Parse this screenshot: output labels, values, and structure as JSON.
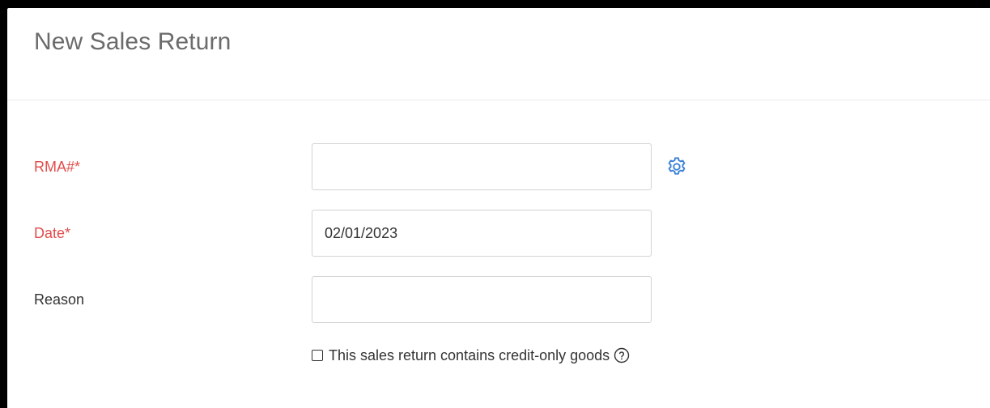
{
  "header": {
    "title": "New Sales Return"
  },
  "form": {
    "rma": {
      "label": "RMA#*",
      "value": "",
      "placeholder": ""
    },
    "date": {
      "label": "Date*",
      "value": "02/01/2023"
    },
    "reason": {
      "label": "Reason",
      "value": ""
    },
    "credit_only": {
      "label": "This sales return contains credit-only goods",
      "checked": false
    }
  },
  "colors": {
    "required_label": "#e34c4c",
    "gear_icon": "#3b82d6",
    "title": "#6b6b6b"
  },
  "icons": {
    "settings": "gear-icon",
    "help": "question-circle-icon"
  }
}
